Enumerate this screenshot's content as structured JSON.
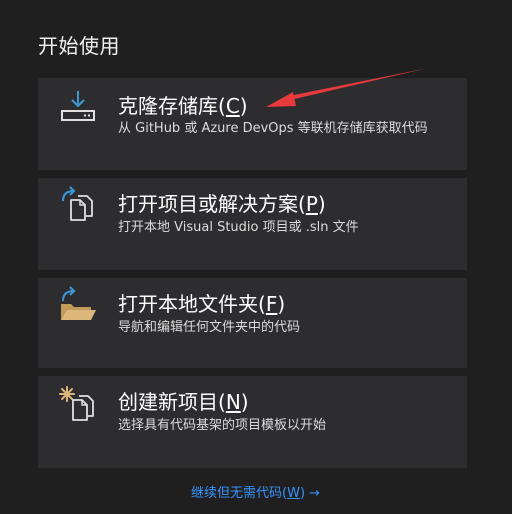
{
  "heading": "开始使用",
  "cards": [
    {
      "title": "克隆存储库",
      "key": "C",
      "description": "从 GitHub 或 Azure DevOps 等联机存储库获取代码",
      "icon": "clone-download-icon"
    },
    {
      "title": "打开项目或解决方案",
      "key": "P",
      "description": "打开本地 Visual Studio 项目或 .sln 文件",
      "icon": "open-project-icon"
    },
    {
      "title": "打开本地文件夹",
      "key": "F",
      "description": "导航和编辑任何文件夹中的代码",
      "icon": "open-folder-icon"
    },
    {
      "title": "创建新项目",
      "key": "N",
      "description": "选择具有代码基架的项目模板以开始",
      "icon": "new-project-icon"
    }
  ],
  "continue": {
    "label": "继续但无需代码",
    "key": "W",
    "arrow": "→"
  },
  "colors": {
    "background": "#1f1f1f",
    "card": "#2d2d30",
    "link": "#3794ff",
    "annotation": "#e8393b",
    "icon_blue": "#3a9ad9",
    "icon_folder": "#dcb67a"
  }
}
